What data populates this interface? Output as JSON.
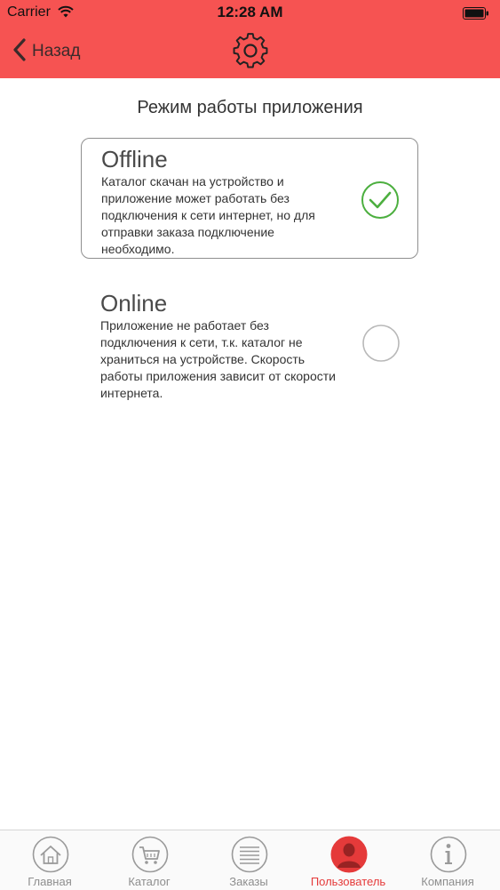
{
  "status_bar": {
    "carrier": "Carrier",
    "time": "12:28 AM"
  },
  "nav": {
    "back_label": "Назад",
    "center_icon": "gear-icon"
  },
  "page": {
    "section_title": "Режим работы приложения"
  },
  "modes": [
    {
      "title": "Offline",
      "description": "Каталог скачан на устройство и приложение может работать без подключения к сети интернет, но для отправки заказа подключение необходимо.",
      "selected": true
    },
    {
      "title": "Online",
      "description": "Приложение не работает без подключения к сети, т.к. каталог не храниться на устройстве. Скорость работы приложения зависит от скорости интернета.",
      "selected": false
    }
  ],
  "tabs": [
    {
      "label": "Главная",
      "icon": "home-icon",
      "active": false
    },
    {
      "label": "Каталог",
      "icon": "cart-icon",
      "active": false
    },
    {
      "label": "Заказы",
      "icon": "list-icon",
      "active": false
    },
    {
      "label": "Пользователь",
      "icon": "user-icon",
      "active": true
    },
    {
      "label": "Компания",
      "icon": "info-icon",
      "active": false
    }
  ],
  "colors": {
    "header": "#f65352",
    "active_tab": "#e53a3a",
    "check": "#4caf3f",
    "inactive": "#8e8e8e"
  }
}
